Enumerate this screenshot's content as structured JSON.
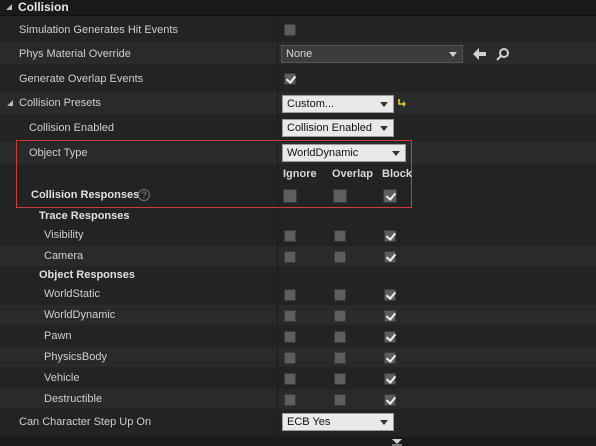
{
  "header": {
    "title": "Collision"
  },
  "rows": {
    "sim_hit": {
      "label": "Simulation Generates Hit Events",
      "checked": false
    },
    "phys_mat": {
      "label": "Phys Material Override",
      "value": "None"
    },
    "overlap": {
      "label": "Generate Overlap Events",
      "checked": true
    },
    "presets": {
      "label": "Collision Presets",
      "value": "Custom..."
    },
    "enabled": {
      "label": "Collision Enabled",
      "value": "Collision Enabled"
    },
    "object_type": {
      "label": "Object Type",
      "value": "WorldDynamic"
    },
    "responses": {
      "label": "Collision Responses"
    },
    "trace": {
      "label": "Trace Responses"
    },
    "object_resp": {
      "label": "Object Responses"
    },
    "step_up": {
      "label": "Can Character Step Up On",
      "value": "ECB Yes"
    }
  },
  "columns": {
    "ignore": "Ignore",
    "overlap": "Overlap",
    "block": "Block"
  },
  "trace_items": [
    {
      "label": "Visibility",
      "ignore": false,
      "overlap": false,
      "block": true
    },
    {
      "label": "Camera",
      "ignore": false,
      "overlap": false,
      "block": true
    }
  ],
  "object_items": [
    {
      "label": "WorldStatic",
      "ignore": false,
      "overlap": false,
      "block": true
    },
    {
      "label": "WorldDynamic",
      "ignore": false,
      "overlap": false,
      "block": true
    },
    {
      "label": "Pawn",
      "ignore": false,
      "overlap": false,
      "block": true
    },
    {
      "label": "PhysicsBody",
      "ignore": false,
      "overlap": false,
      "block": true
    },
    {
      "label": "Vehicle",
      "ignore": false,
      "overlap": false,
      "block": true
    },
    {
      "label": "Destructible",
      "ignore": false,
      "overlap": false,
      "block": true
    }
  ],
  "colors": {
    "highlight": "#d23a3a",
    "reset_arrow": "#e8d02a"
  },
  "icons": [
    "collapse-arrow-icon",
    "back-arrow-icon",
    "search-icon",
    "reset-default-icon",
    "help-icon",
    "expand-more-icon"
  ]
}
